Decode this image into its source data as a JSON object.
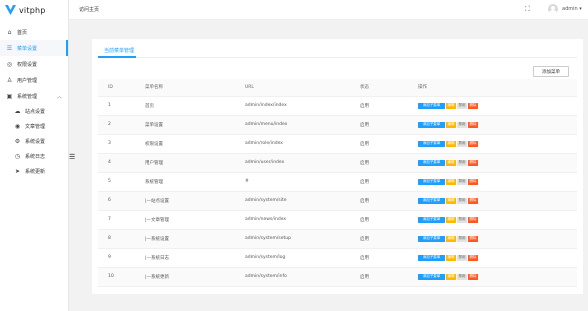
{
  "app": {
    "name": "vitphp"
  },
  "topbar": {
    "tab": "访问主页",
    "user": "admin",
    "user_caret": "▾"
  },
  "sidebar": {
    "items": [
      {
        "label": "首页",
        "icon": "home-icon",
        "glyph": "⌂"
      },
      {
        "label": "菜单设置",
        "icon": "menu-icon",
        "glyph": "☰",
        "active": true
      },
      {
        "label": "权限设置",
        "icon": "shield-icon",
        "glyph": "◎"
      },
      {
        "label": "用户管理",
        "icon": "user-icon",
        "glyph": "♙"
      },
      {
        "label": "系统管理",
        "icon": "system-icon",
        "glyph": "▣",
        "expanded": true
      }
    ],
    "subitems": [
      {
        "label": "站点设置",
        "icon": "cloud-icon",
        "glyph": "☁"
      },
      {
        "label": "文章管理",
        "icon": "globe-icon",
        "glyph": "◉"
      },
      {
        "label": "系统设置",
        "icon": "settings-icon",
        "glyph": "⚙"
      },
      {
        "label": "系统日志",
        "icon": "clock-icon",
        "glyph": "◷"
      },
      {
        "label": "系统更新",
        "icon": "send-icon",
        "glyph": "➤"
      }
    ],
    "collapse_glyph": "☰"
  },
  "card": {
    "title": "当前菜单管理",
    "add_button": "添加菜单"
  },
  "table": {
    "headers": [
      "ID",
      "菜单名称",
      "URL",
      "状态",
      "操作"
    ],
    "rows": [
      {
        "id": "1",
        "name": "首页",
        "url": "admin/index/index",
        "status": "启用"
      },
      {
        "id": "2",
        "name": "菜单设置",
        "url": "admin/menu/index",
        "status": "启用"
      },
      {
        "id": "3",
        "name": "权限设置",
        "url": "admin/role/index",
        "status": "启用"
      },
      {
        "id": "4",
        "name": "用户管理",
        "url": "admin/user/index",
        "status": "启用"
      },
      {
        "id": "5",
        "name": "系统管理",
        "url": "#",
        "status": "启用"
      },
      {
        "id": "6",
        "name": "|—站点设置",
        "url": "admin/system/site",
        "status": "启用"
      },
      {
        "id": "7",
        "name": "|—文章管理",
        "url": "admin/news/index",
        "status": "启用"
      },
      {
        "id": "8",
        "name": "|—系统设置",
        "url": "admin/system/setup",
        "status": "启用"
      },
      {
        "id": "9",
        "name": "|—系统日志",
        "url": "admin/system/log",
        "status": "启用"
      },
      {
        "id": "10",
        "name": "|—系统更新",
        "url": "admin/system/info",
        "status": "启用"
      }
    ],
    "actions": {
      "add": "添加子菜单",
      "edit": "编辑",
      "status": "禁用",
      "delete": "删除"
    }
  },
  "colors": {
    "accent": "#1e9fff",
    "warn": "#ffb800",
    "danger": "#ff5722"
  }
}
